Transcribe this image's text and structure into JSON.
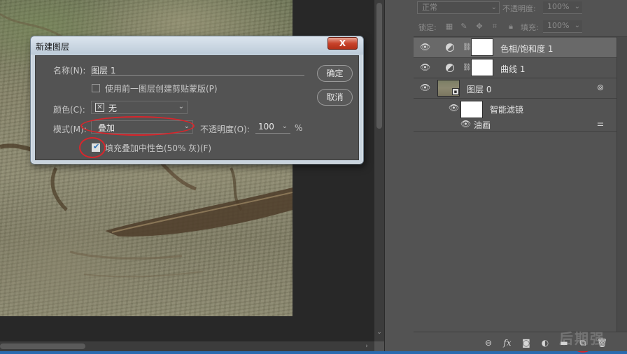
{
  "dialog": {
    "title": "新建图层",
    "close_label": "X",
    "name_label": "名称(N):",
    "name_value": "图层 1",
    "clip_checkbox_label": "使用前一图层创建剪贴蒙版(P)",
    "clip_checked": false,
    "color_label": "颜色(C):",
    "color_value": "无",
    "mode_label": "模式(M):",
    "mode_value": "叠加",
    "opacity_label": "不透明度(O):",
    "opacity_value": "100",
    "opacity_unit": "%",
    "fill_checkbox_label": "填充叠加中性色(50% 灰)(F)",
    "fill_checked": true,
    "ok_label": "确定",
    "cancel_label": "取消"
  },
  "layers_panel": {
    "blend_mode": "正常",
    "opacity_label": "不透明度:",
    "opacity_value": "100%",
    "lock_label": "锁定:",
    "fill_label": "填充:",
    "fill_value": "100%",
    "layers": [
      {
        "name": "色相/饱和度 1",
        "type": "adjustment",
        "selected": true,
        "visible": true
      },
      {
        "name": "曲线 1",
        "type": "adjustment",
        "selected": false,
        "visible": true
      },
      {
        "name": "图层 0",
        "type": "smart-object",
        "selected": false,
        "visible": true
      },
      {
        "name": "智能滤镜",
        "type": "smart-filter-mask",
        "selected": false,
        "visible": true
      },
      {
        "name": "油画",
        "type": "filter",
        "selected": false,
        "visible": true
      }
    ],
    "footer_icons": [
      "link-icon",
      "fx-icon",
      "mask-icon",
      "adjustment-icon",
      "group-folder-icon",
      "new-layer-icon",
      "trash-icon"
    ]
  },
  "watermark": "后期强",
  "colors": {
    "accent_red": "#d8262c",
    "panel_bg": "#535353",
    "selected_row": "#696969",
    "status_blue": "#2a6bb0"
  }
}
